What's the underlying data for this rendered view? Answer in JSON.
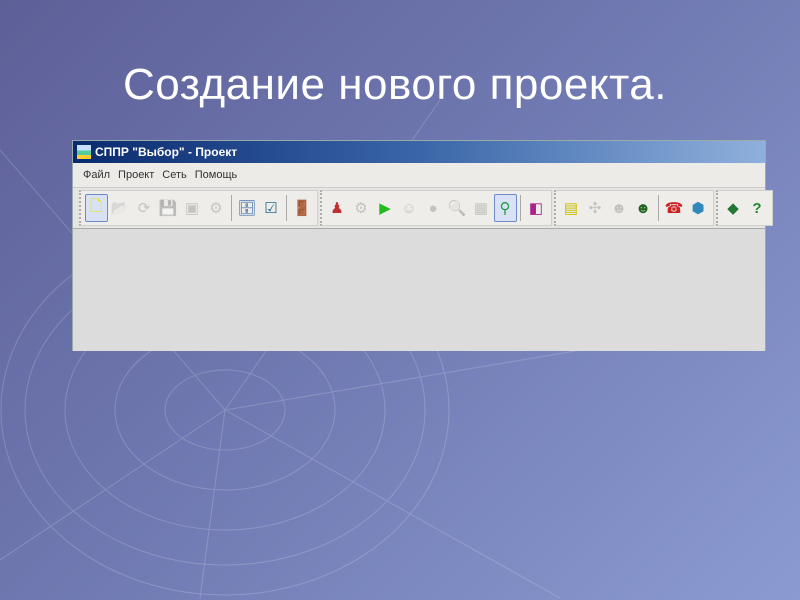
{
  "slide": {
    "title": "Создание нового проекта."
  },
  "window": {
    "title": "СППР \"Выбор\" - Проект"
  },
  "menu": [
    "Файл",
    "Проект",
    "Сеть",
    "Помощь"
  ],
  "toolbar": {
    "groups": [
      [
        {
          "icon": "new-file-icon",
          "glyph": "🗋",
          "color": "#e8e000",
          "state": "active"
        },
        {
          "icon": "open-folder-icon",
          "glyph": "📂",
          "state": "disabled"
        },
        {
          "icon": "reload-icon",
          "glyph": "⟳",
          "state": "disabled"
        },
        {
          "icon": "save-icon",
          "glyph": "💾",
          "state": "disabled"
        },
        {
          "icon": "print-icon",
          "glyph": "▣",
          "state": "disabled"
        },
        {
          "icon": "document-settings-icon",
          "glyph": "⚙",
          "state": "disabled"
        },
        {
          "sep": true
        },
        {
          "icon": "database-icon",
          "glyph": "🗄",
          "color": "#2a5fa0",
          "state": "enabled"
        },
        {
          "icon": "checklist-icon",
          "glyph": "☑",
          "color": "#2a6a8a",
          "state": "enabled"
        },
        {
          "sep": true
        },
        {
          "icon": "exit-door-icon",
          "glyph": "🚪",
          "color": "#2a9a3a",
          "state": "enabled"
        }
      ],
      [
        {
          "icon": "team-icon",
          "glyph": "♟",
          "color": "#c03030",
          "state": "enabled"
        },
        {
          "icon": "gears-icon",
          "glyph": "⚙",
          "state": "disabled"
        },
        {
          "icon": "play-icon",
          "glyph": "▶",
          "color": "#22bb22",
          "state": "enabled"
        },
        {
          "icon": "expert-icon",
          "glyph": "☺",
          "state": "disabled"
        },
        {
          "icon": "globe-icon",
          "glyph": "●",
          "state": "disabled"
        },
        {
          "icon": "preview-icon",
          "glyph": "🔍",
          "state": "disabled"
        },
        {
          "icon": "chart-icon",
          "glyph": "▦",
          "state": "disabled"
        },
        {
          "icon": "search-icon",
          "glyph": "⚲",
          "color": "#229944",
          "state": "active"
        },
        {
          "sep": true
        },
        {
          "icon": "palette-icon",
          "glyph": "◧",
          "color": "#aa2288",
          "state": "enabled"
        }
      ],
      [
        {
          "icon": "document-import-icon",
          "glyph": "▤",
          "color": "#c8c000",
          "state": "enabled"
        },
        {
          "icon": "network-icon",
          "glyph": "✣",
          "state": "disabled"
        },
        {
          "icon": "users-icon",
          "glyph": "☻",
          "state": "disabled"
        },
        {
          "icon": "user-icon",
          "glyph": "☻",
          "color": "#226622",
          "state": "enabled"
        },
        {
          "sep": true
        },
        {
          "icon": "phone-icon",
          "glyph": "☎",
          "color": "#cc2222",
          "state": "enabled"
        },
        {
          "icon": "packages-icon",
          "glyph": "⬢",
          "color": "#3388bb",
          "state": "enabled"
        }
      ],
      [
        {
          "icon": "diamond-icon",
          "glyph": "◆",
          "color": "#227733",
          "state": "enabled"
        },
        {
          "icon": "help-icon",
          "glyph": "?",
          "color": "#228833",
          "state": "enabled"
        }
      ]
    ]
  }
}
